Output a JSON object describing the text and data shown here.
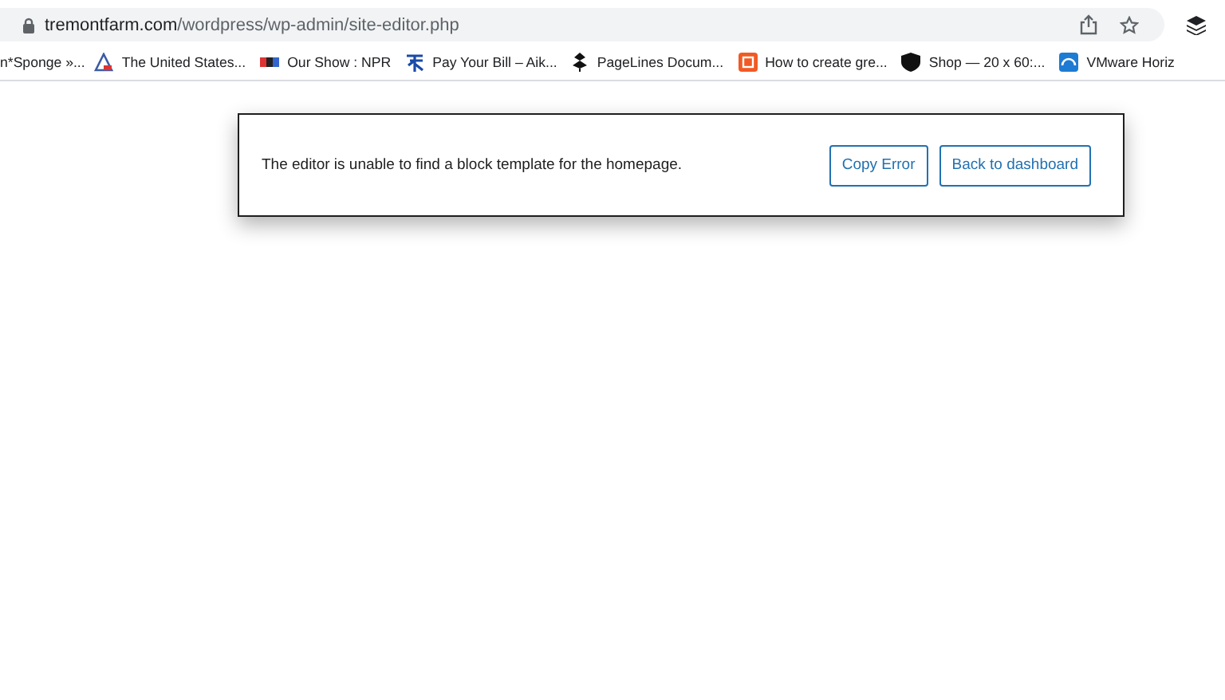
{
  "address_bar": {
    "host": "tremontfarm.com",
    "path": "/wordpress/wp-admin/site-editor.php"
  },
  "bookmarks": [
    {
      "label": "n*Sponge »..."
    },
    {
      "label": "The United States..."
    },
    {
      "label": "Our Show : NPR"
    },
    {
      "label": "Pay Your Bill – Aik..."
    },
    {
      "label": "PageLines Docum..."
    },
    {
      "label": "How to create gre..."
    },
    {
      "label": "Shop — 20 x 60:..."
    },
    {
      "label": "VMware Horiz"
    }
  ],
  "error_notice": {
    "message": "The editor is unable to find a block template for the homepage.",
    "buttons": [
      "Copy Error",
      "Back to dashboard"
    ]
  }
}
